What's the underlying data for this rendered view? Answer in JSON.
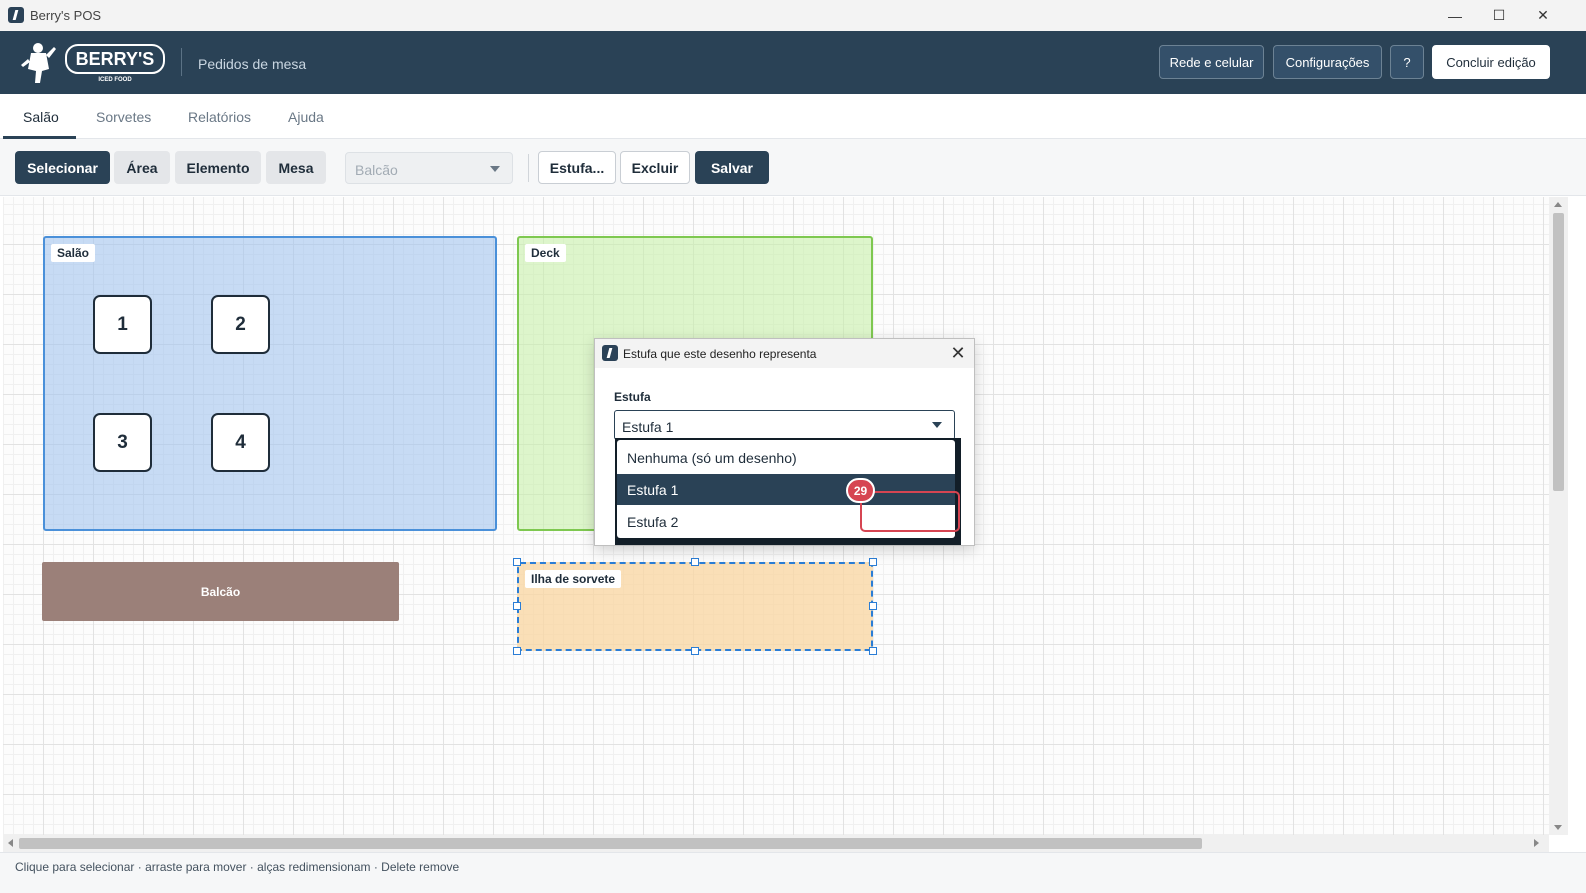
{
  "window": {
    "title": "Berry's POS",
    "controls": {
      "minimize": "—",
      "maximize": "☐",
      "close": "✕"
    }
  },
  "header": {
    "logo_text": "BERRY'S",
    "logo_sub": "ICED FOOD",
    "subtitle": "Pedidos de mesa",
    "buttons": {
      "network": "Rede e celular",
      "settings": "Configurações",
      "help": "?",
      "finish": "Concluir edição"
    }
  },
  "tabs": [
    {
      "label": "Salão",
      "active": true
    },
    {
      "label": "Sorvetes"
    },
    {
      "label": "Relatórios"
    },
    {
      "label": "Ajuda"
    }
  ],
  "toolbar": {
    "select": "Selecionar",
    "area": "Área",
    "element": "Elemento",
    "table": "Mesa",
    "dropdown_value": "Balcão",
    "estufa": "Estufa...",
    "delete": "Excluir",
    "save": "Salvar"
  },
  "canvas": {
    "areas": {
      "salao": {
        "label": "Salão",
        "fill": "#c4d8f2",
        "border": "#4a90d9"
      },
      "deck": {
        "label": "Deck",
        "fill": "#d8f2c4",
        "border": "#7ec850"
      },
      "ilha": {
        "label": "Ilha de sorvete",
        "fill": "#fbe0b6",
        "border": "#2a7dd6"
      }
    },
    "tables": [
      "1",
      "2",
      "3",
      "4"
    ],
    "balcao": {
      "label": "Balcão",
      "fill": "#9b8079"
    }
  },
  "dialog": {
    "title": "Estufa que este desenho representa",
    "close": "✕",
    "field_label": "Estufa",
    "selected_value": "Estufa 1",
    "options": [
      {
        "label": "Nenhuma (só um desenho)"
      },
      {
        "label": "Estufa 1",
        "selected": true
      },
      {
        "label": "Estufa 2"
      }
    ]
  },
  "annotation": {
    "badge": "29",
    "color": "#d64552"
  },
  "status": {
    "hint": "Clique para selecionar · arraste para mover · alças redimensionam · Delete remove"
  },
  "colors": {
    "brand_dark": "#2a4256",
    "accent_blue": "#2a7dd6"
  }
}
